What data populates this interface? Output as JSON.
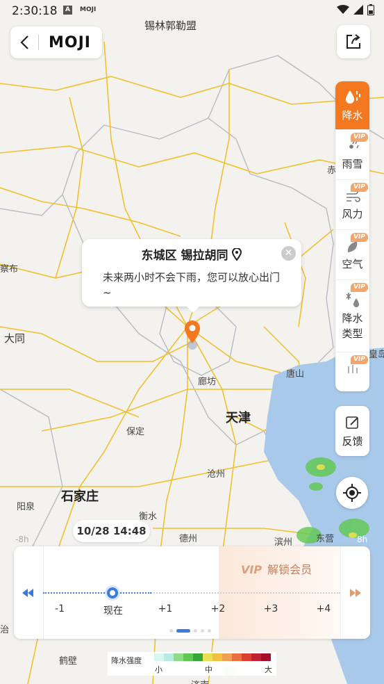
{
  "status_bar": {
    "time": "2:30:18",
    "app_icon_a": "A",
    "app_icon_moji": "MOJI"
  },
  "header": {
    "logo": "MOJI",
    "map_title": "锡林郭勒盟"
  },
  "right_panel": {
    "items": [
      {
        "label": "降水",
        "icon": "rain-drop-icon",
        "vip": false,
        "active": true
      },
      {
        "label": "雨雪",
        "icon": "rain-snow-icon",
        "vip": true,
        "active": false
      },
      {
        "label": "风力",
        "icon": "wind-icon",
        "vip": true,
        "active": false
      },
      {
        "label": "空气",
        "icon": "leaf-icon",
        "vip": true,
        "active": false
      },
      {
        "label": "降水类型",
        "icon": "precip-type-icon",
        "vip": true,
        "active": false
      },
      {
        "label": "",
        "icon": "temperature-icon",
        "vip": true,
        "active": false
      }
    ],
    "vip_badge": "VIP",
    "feedback": "反馈"
  },
  "popup": {
    "title": "东城区 锡拉胡同",
    "message": "未来两小时不会下雨，您可以放心出门~"
  },
  "map_labels": {
    "tianjin": "天津",
    "shijiazhuang": "石家庄",
    "langfang": "廊坊",
    "baoding": "保定",
    "tangshan": "唐山",
    "cangzhou": "沧州",
    "hengshui": "衡水",
    "dezhou": "德州",
    "datong": "大同",
    "yangquan": "阳泉",
    "binzhou": "滨州",
    "dongying": "东营",
    "hebi": "鹤壁",
    "jinan": "济南",
    "chaha": "察布",
    "chi": "赤",
    "huangdao": "皇岛",
    "zhi": "治"
  },
  "time_label": "10/28 14:48",
  "edge_labels": {
    "left": "-8h",
    "right": "8h"
  },
  "timeline": {
    "vip_tag": "VIP",
    "vip_text": "解锁会员",
    "ticks": [
      "-1",
      "现在",
      "+1",
      "+2",
      "+3",
      "+4"
    ],
    "pages": 5,
    "active_page": 1,
    "current_position": 0.31
  },
  "legend": {
    "title": "降水强度",
    "low": "小",
    "mid": "中",
    "high": "大",
    "colors": [
      "#d9f6f0",
      "#b8ece2",
      "#8fdc88",
      "#5fc84e",
      "#35a63a",
      "#e8e050",
      "#f0c040",
      "#f0a050",
      "#e87040",
      "#d84030",
      "#c02030",
      "#a01028"
    ]
  },
  "colors": {
    "accent": "#f4781f",
    "timeline_blue": "#3a7be0"
  }
}
